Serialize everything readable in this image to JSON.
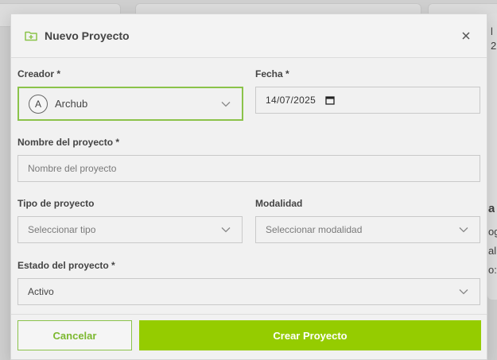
{
  "background": {
    "right_snippets": [
      "l",
      "2",
      "a",
      "og",
      "alid",
      "o:"
    ]
  },
  "modal": {
    "title": "Nuevo Proyecto",
    "title_icon": "folder-plus-icon",
    "close_icon": "close-icon"
  },
  "form": {
    "creator": {
      "label": "Creador *",
      "avatar_initial": "A",
      "value": "Archub"
    },
    "date": {
      "label": "Fecha *",
      "value": "14/07/2025"
    },
    "project_name": {
      "label": "Nombre del proyecto *",
      "placeholder": "Nombre del proyecto"
    },
    "project_type": {
      "label": "Tipo de proyecto",
      "placeholder": "Seleccionar tipo"
    },
    "modality": {
      "label": "Modalidad",
      "placeholder": "Seleccionar modalidad"
    },
    "status": {
      "label": "Estado del proyecto *",
      "value": "Activo"
    }
  },
  "footer": {
    "cancel_label": "Cancelar",
    "create_label": "Crear Proyecto"
  },
  "colors": {
    "accent": "#95cc00",
    "accent_border": "#8bc34a",
    "accent_text": "#7cb82f"
  }
}
